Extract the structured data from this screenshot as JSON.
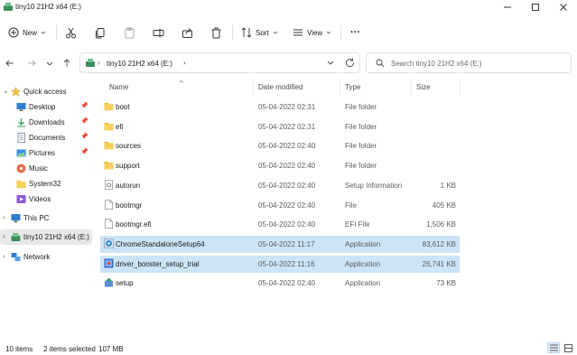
{
  "window": {
    "title": "tiny10 21H2 x64 (E:)",
    "minimize_icon": "minimize-icon",
    "maximize_icon": "maximize-icon",
    "close_icon": "close-icon"
  },
  "toolbar": {
    "new_label": "New",
    "sort_label": "Sort",
    "view_label": "View",
    "more_label": "···"
  },
  "address": {
    "path": "tiny10 21H2 x64 (E:)",
    "search_placeholder": "Search tiny10 21H2 x64 (E:)"
  },
  "sidebar": {
    "quick_access": "Quick access",
    "items": [
      {
        "label": "Desktop",
        "icon": "desktop-icon",
        "pinned": true
      },
      {
        "label": "Downloads",
        "icon": "downloads-icon",
        "pinned": true
      },
      {
        "label": "Documents",
        "icon": "documents-icon",
        "pinned": true
      },
      {
        "label": "Pictures",
        "icon": "pictures-icon",
        "pinned": true
      },
      {
        "label": "Music",
        "icon": "music-icon",
        "pinned": false
      },
      {
        "label": "System32",
        "icon": "folder-icon",
        "pinned": false
      },
      {
        "label": "Videos",
        "icon": "videos-icon",
        "pinned": false
      }
    ],
    "this_pc": "This PC",
    "drive": "tiny10 21H2 x64 (E:)",
    "network": "Network"
  },
  "columns": {
    "name": "Name",
    "date": "Date modified",
    "type": "Type",
    "size": "Size"
  },
  "files": [
    {
      "name": "boot",
      "date": "05-04-2022 02:31",
      "type": "File folder",
      "size": "",
      "icon": "folder-icon",
      "selected": false
    },
    {
      "name": "efi",
      "date": "05-04-2022 02:31",
      "type": "File folder",
      "size": "",
      "icon": "folder-icon",
      "selected": false
    },
    {
      "name": "sources",
      "date": "05-04-2022 02:40",
      "type": "File folder",
      "size": "",
      "icon": "folder-icon",
      "selected": false
    },
    {
      "name": "support",
      "date": "05-04-2022 02:40",
      "type": "File folder",
      "size": "",
      "icon": "folder-icon",
      "selected": false
    },
    {
      "name": "autorun",
      "date": "05-04-2022 02:40",
      "type": "Setup Information",
      "size": "1 KB",
      "icon": "settings-file-icon",
      "selected": false
    },
    {
      "name": "bootmgr",
      "date": "05-04-2022 02:40",
      "type": "File",
      "size": "405 KB",
      "icon": "file-icon",
      "selected": false
    },
    {
      "name": "bootmgr.efi",
      "date": "05-04-2022 02:40",
      "type": "EFI File",
      "size": "1,506 KB",
      "icon": "file-icon",
      "selected": false
    },
    {
      "name": "ChromeStandaloneSetup64",
      "date": "05-04-2022 11:17",
      "type": "Application",
      "size": "83,612 KB",
      "icon": "chrome-setup-icon",
      "selected": true
    },
    {
      "name": "driver_booster_setup_trial",
      "date": "05-04-2022 11:16",
      "type": "Application",
      "size": "26,741 KB",
      "icon": "installer-icon",
      "selected": true
    },
    {
      "name": "setup",
      "date": "05-04-2022 02:40",
      "type": "Application",
      "size": "73 KB",
      "icon": "setup-icon",
      "selected": false
    }
  ],
  "status": {
    "item_count": "10 items",
    "selection": "2 items selected",
    "size": "107 MB"
  },
  "colors": {
    "selection": "#cce4f7",
    "folder": "#f4c542",
    "accent": "#0067c0"
  }
}
